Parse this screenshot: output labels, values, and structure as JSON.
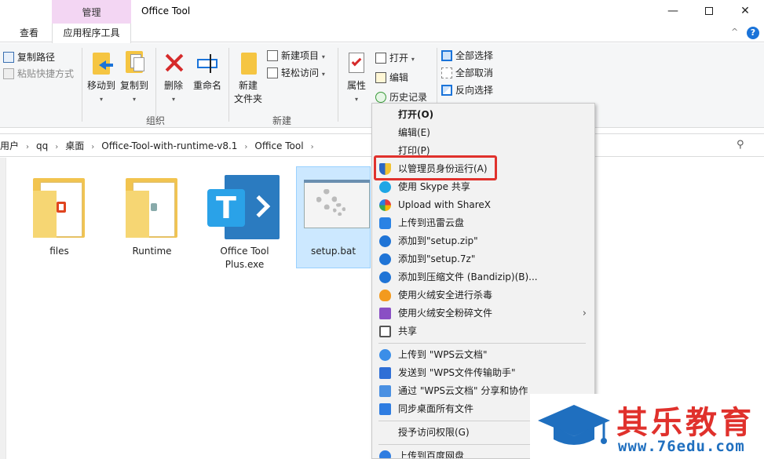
{
  "window": {
    "context_tab": "管理",
    "title": "Office Tool",
    "minimize": "—",
    "close": "✕"
  },
  "tabs": {
    "view": "查看",
    "app_tools": "应用程序工具",
    "collapse": "^",
    "help": "?"
  },
  "ribbon": {
    "copy_path": "复制路径",
    "paste_shortcut": "粘贴快捷方式",
    "move_to": "移动到",
    "copy_to": "复制到",
    "delete": "删除",
    "rename": "重命名",
    "new_folder_line1": "新建",
    "new_folder_line2": "文件夹",
    "new_item": "新建项目",
    "easy_access": "轻松访问",
    "properties": "属性",
    "open": "打开",
    "edit": "编辑",
    "history": "历史记录",
    "select_all": "全部选择",
    "select_none": "全部取消",
    "invert_selection": "反向选择",
    "group_organize": "组织",
    "group_new": "新建",
    "dropdown_caret": "▾"
  },
  "address": {
    "crumbs": [
      "用户",
      "qq",
      "桌面",
      "Office-Tool-with-runtime-v8.1",
      "Office Tool"
    ],
    "separator": "›",
    "search_icon": "⚲"
  },
  "files": [
    {
      "name": "files"
    },
    {
      "name": "Runtime"
    },
    {
      "name": "Office Tool Plus.exe"
    },
    {
      "name": "setup.bat",
      "selected": true
    }
  ],
  "context_menu": {
    "items": [
      {
        "label": "打开(O)",
        "bold": true
      },
      {
        "label": "编辑(E)"
      },
      {
        "label": "打印(P)"
      },
      {
        "label": "以管理员身份运行(A)",
        "icon": "uac-shield-icon",
        "highlighted": true
      },
      {
        "label": "使用 Skype 共享",
        "icon": "skype-icon"
      },
      {
        "label": "Upload with ShareX",
        "icon": "sharex-icon"
      },
      {
        "label": "上传到迅雷云盘",
        "icon": "thunder-cloud-icon"
      },
      {
        "label": "添加到\"setup.zip\"",
        "icon": "bandizip-icon"
      },
      {
        "label": "添加到\"setup.7z\"",
        "icon": "bandizip-icon"
      },
      {
        "label": "添加到压缩文件 (Bandizip)(B)...",
        "icon": "bandizip-icon"
      },
      {
        "label": "使用火绒安全进行杀毒",
        "icon": "huorong-icon"
      },
      {
        "label": "使用火绒安全粉碎文件",
        "icon": "shredder-icon",
        "submenu": "›"
      },
      {
        "label": "共享",
        "icon": "share-icon"
      },
      {
        "label": "上传到 \"WPS云文档\"",
        "icon": "wps-cloud-icon"
      },
      {
        "label": "发送到 \"WPS文件传输助手\"",
        "icon": "wps-send-icon"
      },
      {
        "label": "通过 \"WPS云文档\" 分享和协作",
        "icon": "wps-share-icon"
      },
      {
        "label": "同步桌面所有文件",
        "icon": "sync-icon"
      },
      {
        "label": "授予访问权限(G)",
        "submenu": "›"
      },
      {
        "label": "上传到百度网盘",
        "icon": "baidu-icon"
      }
    ]
  },
  "watermark": {
    "brand": "其乐教育",
    "url": "www.76edu.com"
  },
  "colors": {
    "context_tab_bg": "#f3d6f3",
    "selection_bg": "#cce8ff",
    "highlight_red": "#e0312c",
    "accent_blue": "#1a73d9"
  }
}
